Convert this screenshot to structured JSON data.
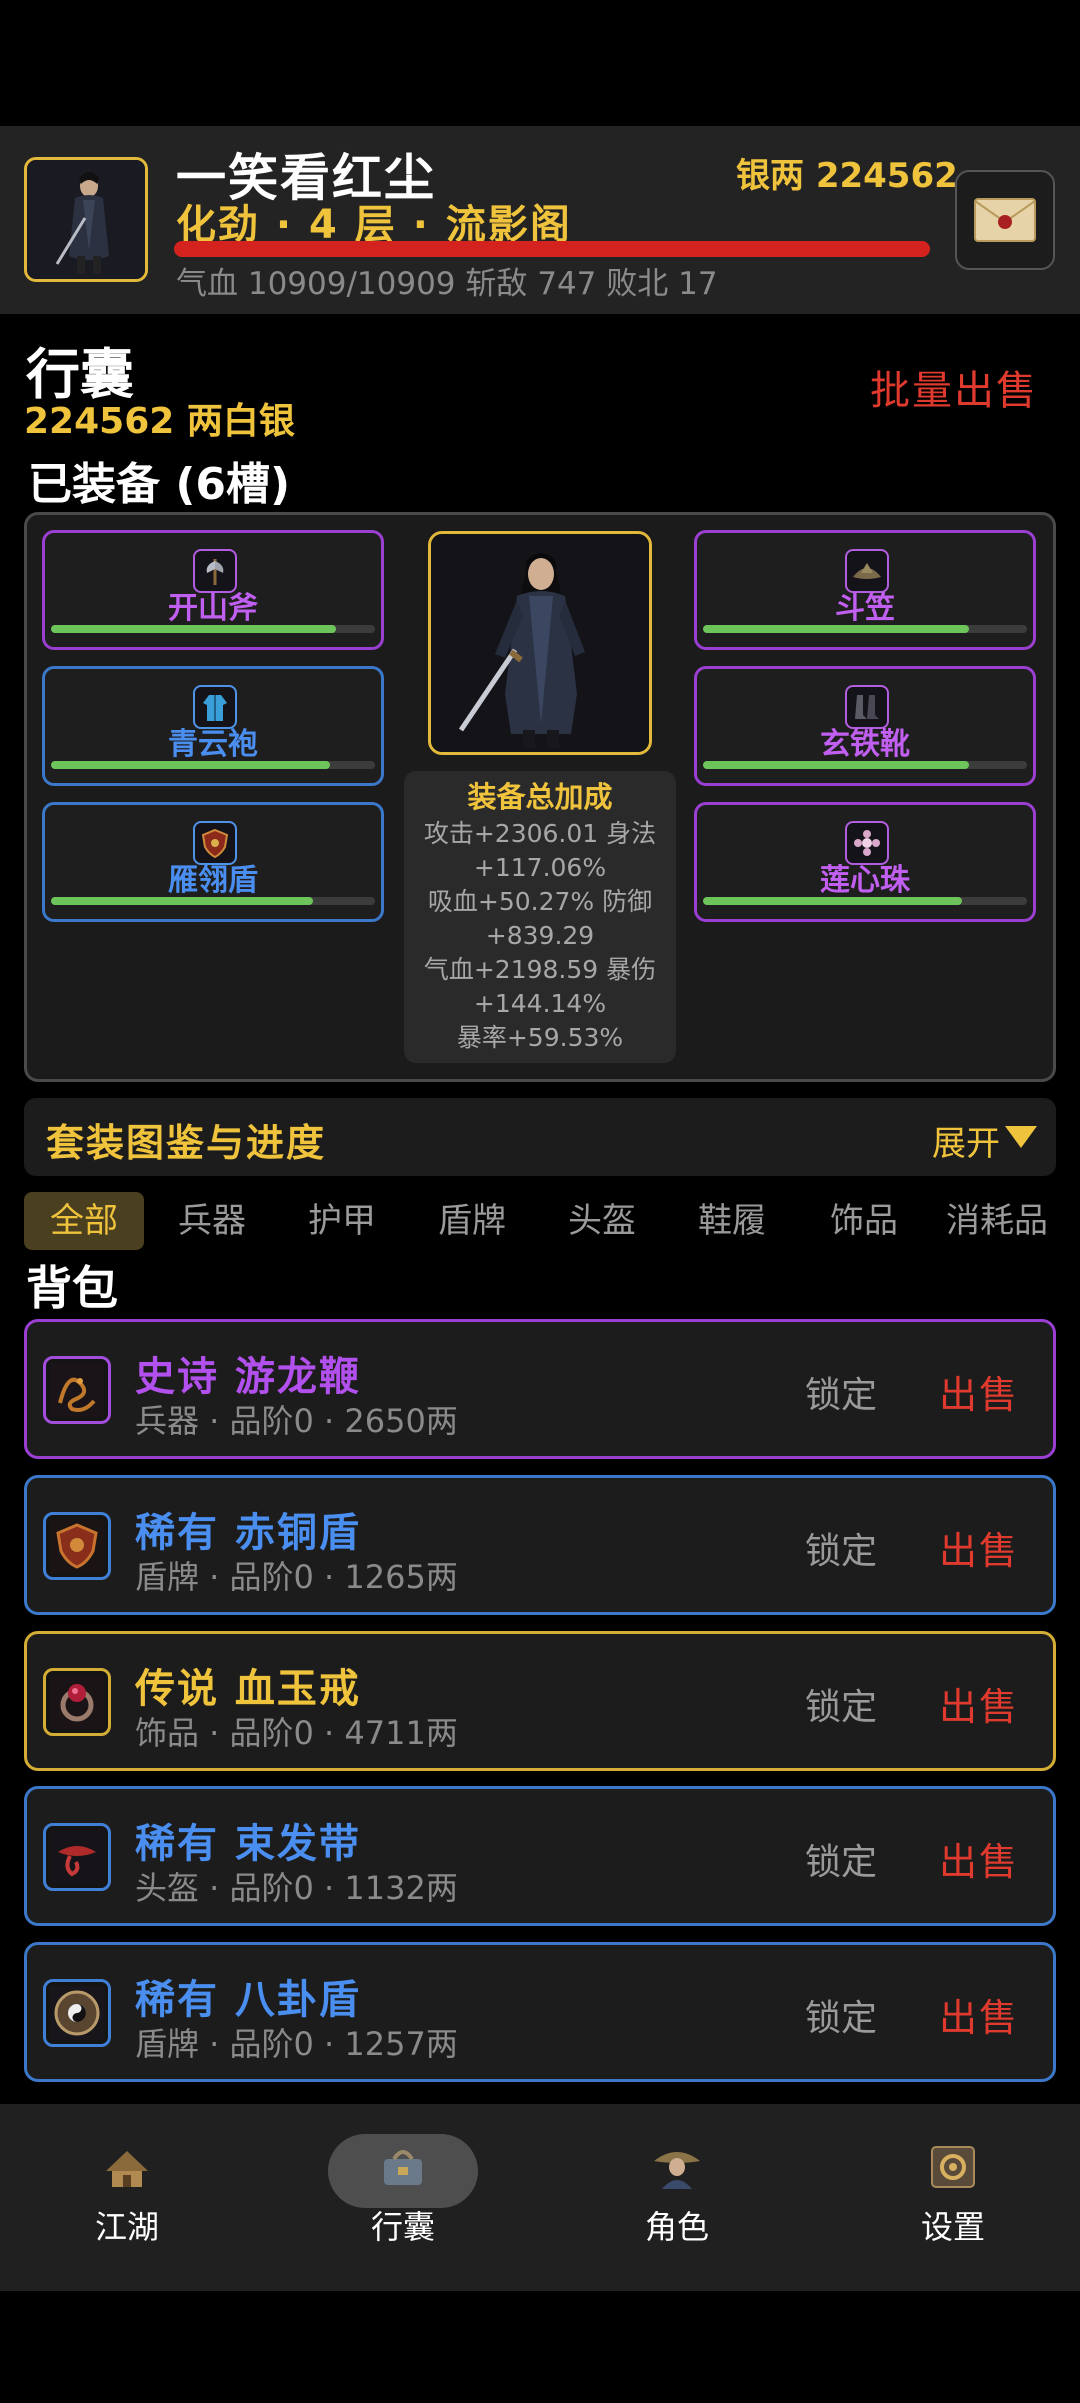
{
  "player": {
    "name": "一笑看红尘",
    "realm": "化劲 · 4 层 · 流影阁",
    "silver_label": "银两 224562",
    "stats": "气血 10909/10909   斩敌 747   败北 17",
    "hp_fraction": 1.0
  },
  "inventory": {
    "title": "行囊",
    "silver": "224562 两白银",
    "bulk_sell": "批量出售",
    "equipped_title": "已装备 (6槽)"
  },
  "equipped_slots": [
    {
      "name": "开山斧",
      "rarity": "purple",
      "icon": "axe-icon",
      "durability": 0.88
    },
    {
      "name": "青云袍",
      "rarity": "blue",
      "icon": "robe-icon",
      "durability": 0.86
    },
    {
      "name": "雁翎盾",
      "rarity": "blue",
      "icon": "shield-icon",
      "durability": 0.81
    },
    {
      "name": "斗笠",
      "rarity": "purple",
      "icon": "hat-icon",
      "durability": 0.82
    },
    {
      "name": "玄铁靴",
      "rarity": "purple",
      "icon": "boots-icon",
      "durability": 0.82
    },
    {
      "name": "莲心珠",
      "rarity": "purple",
      "icon": "lotus-bead-icon",
      "durability": 0.8
    }
  ],
  "bonus": {
    "title": "装备总加成",
    "lines": [
      "攻击+2306.01 身法",
      "+117.06%",
      "吸血+50.27% 防御",
      "+839.29",
      "气血+2198.59 暴伤",
      "+144.14%",
      "暴率+59.53%"
    ]
  },
  "set_collection": {
    "title": "套装图鉴与进度",
    "expand_label": "展开"
  },
  "tabs": [
    "全部",
    "兵器",
    "护甲",
    "盾牌",
    "头盔",
    "鞋履",
    "饰品",
    "消耗品"
  ],
  "active_tab": "全部",
  "backpack_title": "背包",
  "items": [
    {
      "title": "史诗 游龙鞭",
      "subtitle": "兵器 · 品阶0 · 2650两",
      "rarity": "purple",
      "icon": "dragon-whip-icon",
      "lock": "锁定",
      "sell": "出售"
    },
    {
      "title": "稀有 赤铜盾",
      "subtitle": "盾牌 · 品阶0 · 1265两",
      "rarity": "blue",
      "icon": "bronze-shield-icon",
      "lock": "锁定",
      "sell": "出售"
    },
    {
      "title": "传说 血玉戒",
      "subtitle": "饰品 · 品阶0 · 4711两",
      "rarity": "gold",
      "icon": "jade-ring-icon",
      "lock": "锁定",
      "sell": "出售"
    },
    {
      "title": "稀有 束发带",
      "subtitle": "头盔 · 品阶0 · 1132两",
      "rarity": "blue",
      "icon": "headband-icon",
      "lock": "锁定",
      "sell": "出售"
    },
    {
      "title": "稀有 八卦盾",
      "subtitle": "盾牌 · 品阶0 · 1257两",
      "rarity": "blue",
      "icon": "bagua-shield-icon",
      "lock": "锁定",
      "sell": "出售"
    }
  ],
  "nav": [
    {
      "label": "江湖",
      "icon": "jianghu-icon"
    },
    {
      "label": "行囊",
      "icon": "bag-icon"
    },
    {
      "label": "角色",
      "icon": "character-icon"
    },
    {
      "label": "设置",
      "icon": "settings-icon"
    }
  ],
  "colors": {
    "gold": "#f0c33c",
    "purple": "#9a3fd1",
    "blue": "#3b78c9",
    "red": "#e03a2e",
    "hp": "#d4231f",
    "durability": "#6cc45a"
  }
}
